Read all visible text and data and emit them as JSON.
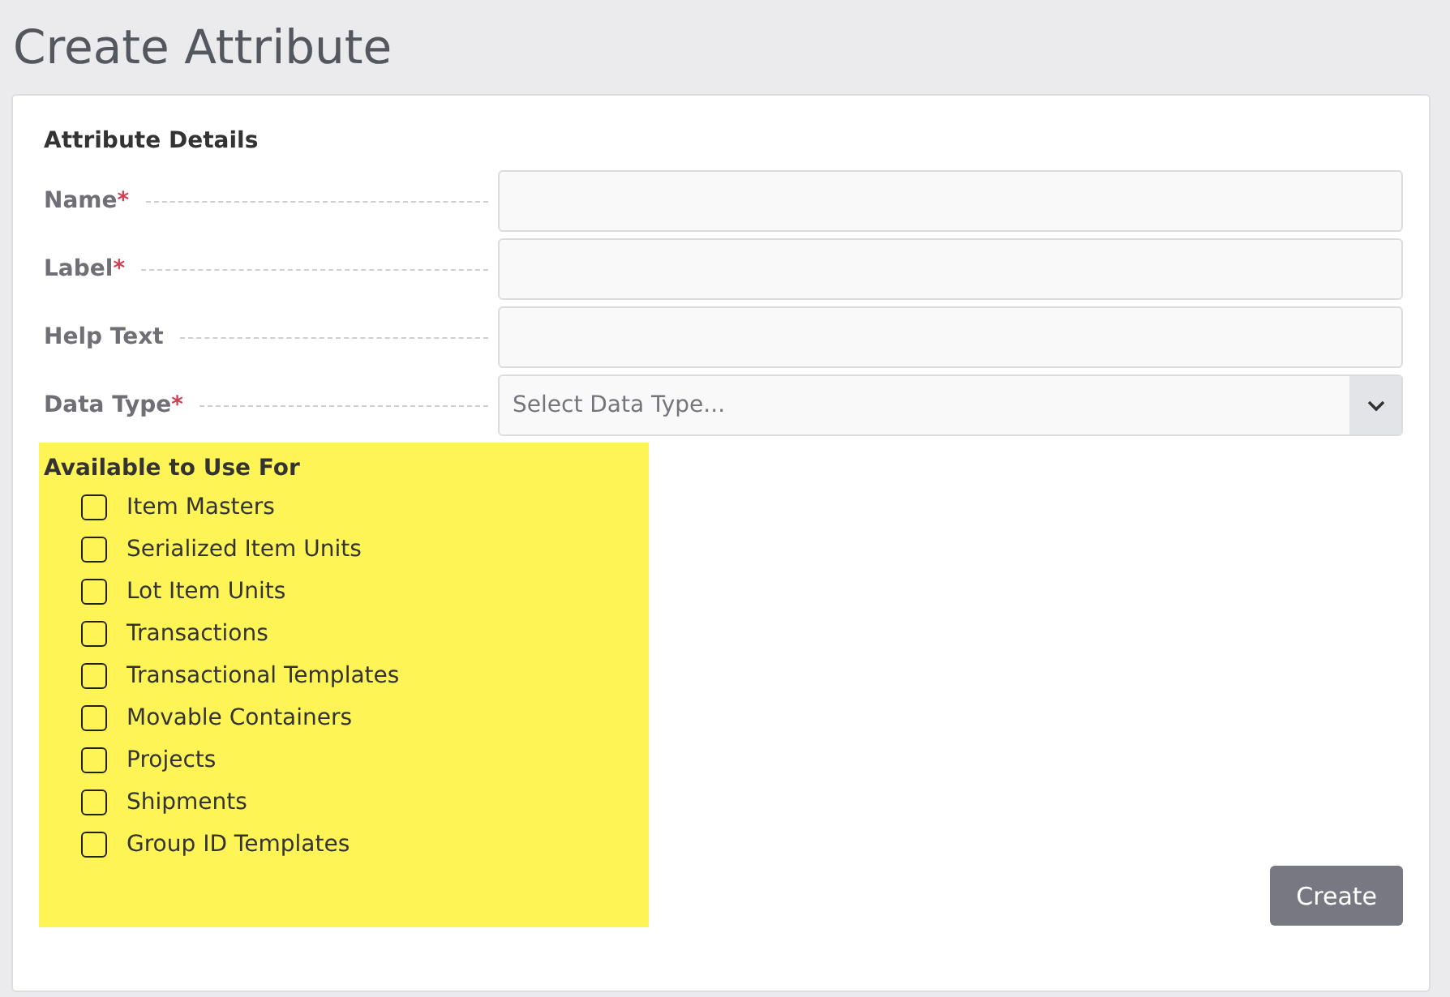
{
  "page_title": "Create Attribute",
  "section_title": "Attribute Details",
  "fields": [
    {
      "kind": "text",
      "label": "Name",
      "required": true
    },
    {
      "kind": "text",
      "label": "Label",
      "required": true
    },
    {
      "kind": "text",
      "label": "Help Text",
      "required": false
    },
    {
      "kind": "select",
      "label": "Data Type",
      "required": true,
      "placeholder": "Select Data Type..."
    }
  ],
  "required_mark": "*",
  "availability": {
    "title": "Available to Use For",
    "highlighted": true,
    "options": [
      {
        "label": "Item Masters",
        "checked": false
      },
      {
        "label": "Serialized Item Units",
        "checked": false
      },
      {
        "label": "Lot Item Units",
        "checked": false
      },
      {
        "label": "Transactions",
        "checked": false
      },
      {
        "label": "Transactional Templates",
        "checked": false
      },
      {
        "label": "Movable Containers",
        "checked": false
      },
      {
        "label": "Projects",
        "checked": false
      },
      {
        "label": "Shipments",
        "checked": false
      },
      {
        "label": "Group ID Templates",
        "checked": false
      }
    ]
  },
  "buttons": [
    {
      "label": "Create"
    }
  ]
}
